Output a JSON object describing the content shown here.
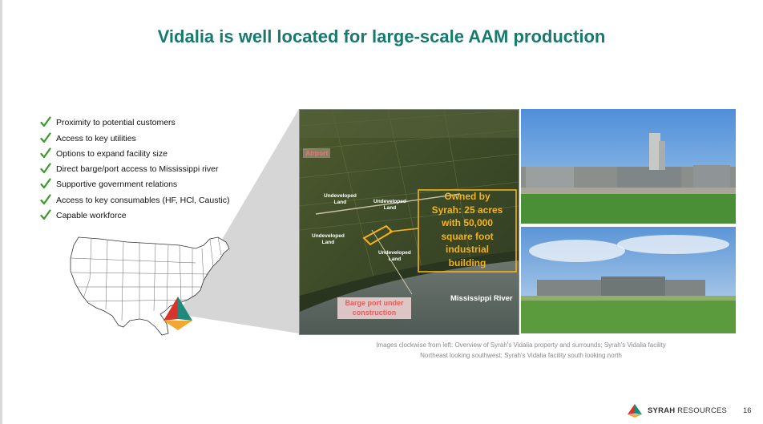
{
  "title": "Vidalia is well located for large-scale AAM production",
  "benefits": [
    "Proximity to potential customers",
    "Access to key utilities",
    "Options to expand facility size",
    "Direct barge/port access to Mississippi river",
    "Supportive government relations",
    "Access to key consumables (HF, HCl, Caustic)",
    "Capable workforce"
  ],
  "aerial_labels": {
    "airport": "Airport",
    "undeveloped_land": "Undeveloped\nLand",
    "owned_by_syrah": "Owned by\nSyrah: 25 acres\nwith 50,000\nsquare foot\nindustrial\nbuilding",
    "barge_port": "Barge port under\nconstruction",
    "river": "Mississippi River"
  },
  "caption": {
    "line1": "Images clockwise from left: Overview of Syrah's Vidalia property and surrounds; Syrah's Vidalia facility",
    "line2": "Northeast looking southwest; Syrah's Vidalia facility south looking north"
  },
  "footer": {
    "brand_bold": "SYRAH",
    "brand_rest": " RESOURCES",
    "page_number": "16"
  },
  "colors": {
    "title_teal": "#187a6e",
    "check_green": "#3a9a2a",
    "logo_red": "#d9342b",
    "logo_teal": "#1f8a7c",
    "logo_gold": "#f0a830",
    "highlight_yellow": "#f5b31a"
  },
  "icons": [
    "check-icon",
    "us-map",
    "syrah-logo-icon"
  ]
}
